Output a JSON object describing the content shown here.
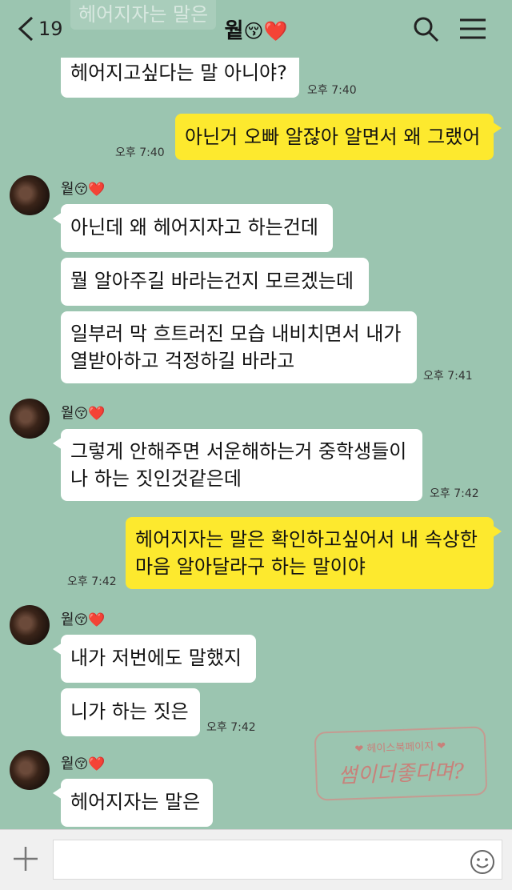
{
  "header": {
    "back_count": "19",
    "title": "웥",
    "title_emoji": "😚❤️",
    "ghost_text": "헤어지자는 말은",
    "icons": [
      "chevron-left-icon",
      "search-icon",
      "menu-icon"
    ]
  },
  "contact": {
    "name": "웥",
    "emoji": "😚❤️"
  },
  "messages": {
    "m1": {
      "text": "헤어지고싶다는 말 아니야?",
      "time": "오후 7:40"
    },
    "m2": {
      "text": "아닌거 오빠 알잖아 알면서 왜 그랬어",
      "time": "오후 7:40"
    },
    "m3": {
      "text": "아닌데 왜 헤어지자고 하는건데"
    },
    "m4": {
      "text": "뭘 알아주길 바라는건지 모르겠는데"
    },
    "m5": {
      "line1": "일부러 막 흐트러진 모습 내비치면서 내가",
      "line2": "열받아하고 걱정하길 바라고",
      "time": "오후 7:41"
    },
    "m6": {
      "line1": "그렇게 안해주면 서운해하는거 중학생들이",
      "line2": "나 하는 짓인것같은데",
      "time": "오후 7:42"
    },
    "m7": {
      "line1": "헤어지자는 말은 확인하고싶어서 내 속상한",
      "line2": "마음 알아달라구 하는 말이야",
      "time": "오후 7:42"
    },
    "m8": {
      "text": "내가 저번에도 말했지"
    },
    "m9": {
      "text": "니가 하는 짓은",
      "time": "오후 7:42"
    },
    "m10": {
      "text": "헤어지자는 말은"
    }
  },
  "watermark": {
    "line1": "❤ 헤이스북페이지 ❤",
    "line2": "썸이더좋다며?"
  },
  "input": {
    "placeholder": "",
    "value": "",
    "hash": "#"
  },
  "colors": {
    "background": "#9bc5b0",
    "my_bubble": "#fde92e",
    "their_bubble": "#ffffff",
    "input_bar": "#f0f0f0"
  }
}
